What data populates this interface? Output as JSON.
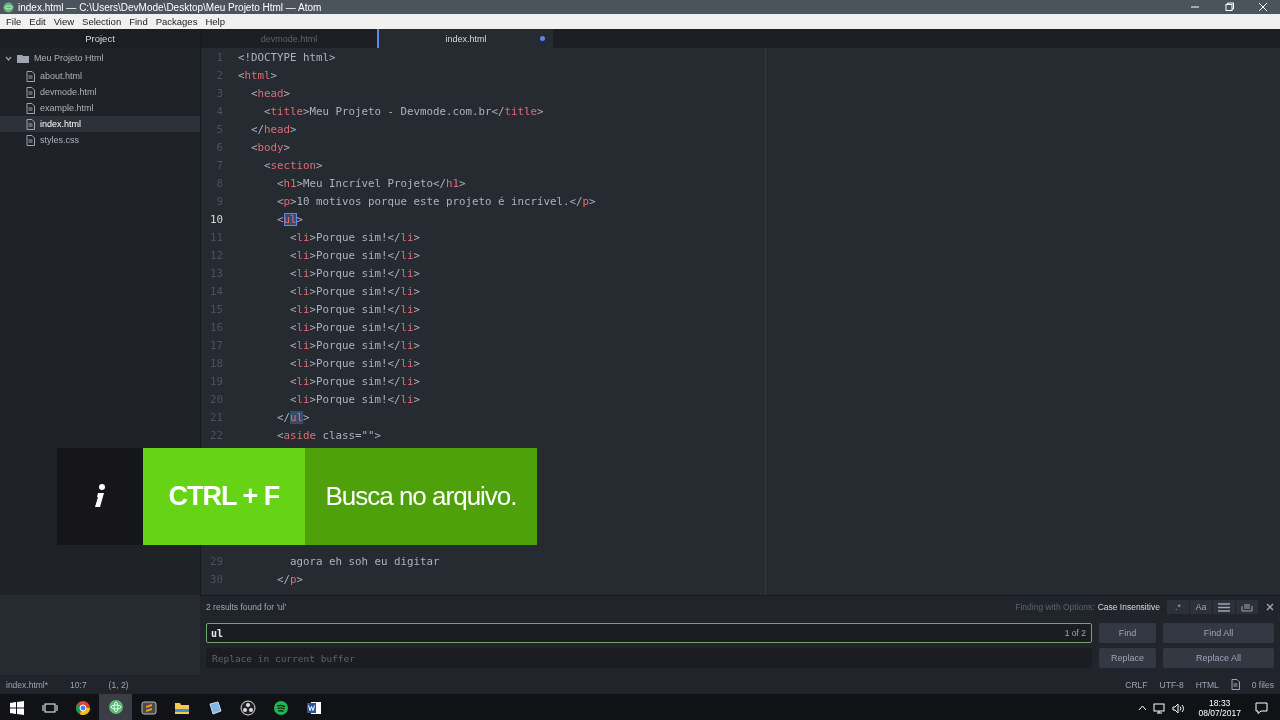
{
  "window": {
    "title": "index.html — C:\\Users\\DevMode\\Desktop\\Meu Projeto Html — Atom"
  },
  "menu": [
    "File",
    "Edit",
    "View",
    "Selection",
    "Find",
    "Packages",
    "Help"
  ],
  "sidebar": {
    "title": "Project",
    "tree": [
      {
        "label": "Meu Projeto Html",
        "expanded": true,
        "selected": false,
        "children": [
          {
            "label": "about.html",
            "selected": false
          },
          {
            "label": "devmode.html",
            "selected": false
          },
          {
            "label": "example.html",
            "selected": false
          },
          {
            "label": "index.html",
            "selected": true
          },
          {
            "label": "styles.css",
            "selected": false
          }
        ]
      }
    ]
  },
  "tabs": [
    {
      "label": "devmode.html",
      "selected": false,
      "modified": false
    },
    {
      "label": "index.html",
      "selected": true,
      "modified": true
    }
  ],
  "editor": {
    "lines": [
      {
        "number": "1",
        "current": false,
        "text": "<!DOCTYPE html>"
      },
      {
        "number": "2",
        "current": false,
        "text": "<html>"
      },
      {
        "number": "3",
        "current": false,
        "text": "  <head>"
      },
      {
        "number": "4",
        "current": false,
        "text": "    <title>Meu Projeto - Devmode.com.br</title>"
      },
      {
        "number": "5",
        "current": false,
        "text": "  </head>"
      },
      {
        "number": "6",
        "current": false,
        "text": "  <body>"
      },
      {
        "number": "7",
        "current": false,
        "text": "    <section>"
      },
      {
        "number": "8",
        "current": false,
        "text": "      <h1>Meu Incrível Projeto</h1>"
      },
      {
        "number": "9",
        "current": false,
        "text": "      <p>10 motivos porque este projeto é incrível.</p>"
      },
      {
        "number": "10",
        "current": true,
        "parts": [
          {
            "text": "      <",
            "kind": "text"
          },
          {
            "text": "ul",
            "kind": "current-match"
          },
          {
            "text": ">",
            "kind": "text"
          }
        ]
      },
      {
        "number": "11",
        "current": false,
        "text": "        <li>Porque sim!</li>"
      },
      {
        "number": "12",
        "current": false,
        "text": "        <li>Porque sim!</li>"
      },
      {
        "number": "13",
        "current": false,
        "text": "        <li>Porque sim!</li>"
      },
      {
        "number": "14",
        "current": false,
        "text": "        <li>Porque sim!</li>"
      },
      {
        "number": "15",
        "current": false,
        "text": "        <li>Porque sim!</li>"
      },
      {
        "number": "16",
        "current": false,
        "text": "        <li>Porque sim!</li>"
      },
      {
        "number": "17",
        "current": false,
        "text": "        <li>Porque sim!</li>"
      },
      {
        "number": "18",
        "current": false,
        "text": "        <li>Porque sim!</li>"
      },
      {
        "number": "19",
        "current": false,
        "text": "        <li>Porque sim!</li>"
      },
      {
        "number": "20",
        "current": false,
        "text": "        <li>Porque sim!</li>"
      },
      {
        "number": "21",
        "current": false,
        "parts": [
          {
            "text": "      </",
            "kind": "text"
          },
          {
            "text": "ul",
            "kind": "match"
          },
          {
            "text": ">",
            "kind": "text"
          }
        ]
      },
      {
        "number": "22",
        "current": false,
        "text": "      <aside class=\"\">"
      },
      {
        "number": "29",
        "current": false,
        "text": "        agora eh soh eu digitar"
      },
      {
        "number": "30",
        "current": false,
        "text": "      </p>"
      }
    ]
  },
  "banner": {
    "key": "CTRL + F",
    "caption": "Busca no arquivo."
  },
  "find": {
    "results": "2 results found for 'ul'",
    "options_label": "Finding with Options:",
    "options_value": "Case Insensitive",
    "options": [
      {
        "kind": "regex",
        "label": ".*",
        "on": false
      },
      {
        "kind": "case",
        "label": "Aa",
        "on": false
      },
      {
        "kind": "selection",
        "on": false
      },
      {
        "kind": "word",
        "on": false
      }
    ],
    "find_value": "ul",
    "counter": "1 of 2",
    "find_button": "Find",
    "find_all_button": "Find All",
    "replace_placeholder": "Replace in current buffer",
    "replace_button": "Replace",
    "replace_all_button": "Replace All"
  },
  "status_bar": {
    "left": [
      "index.html*",
      "10:7",
      "(1, 2)"
    ],
    "right": [
      "CRLF",
      "UTF-8",
      "HTML"
    ],
    "files": "0 files"
  },
  "taskbar": {
    "apps": [
      {
        "kind": "task-view",
        "active": false
      },
      {
        "kind": "browser",
        "active": false
      },
      {
        "kind": "atom",
        "active": true
      },
      {
        "kind": "sublime",
        "active": false
      },
      {
        "kind": "folder",
        "active": false
      },
      {
        "kind": "app",
        "active": false
      },
      {
        "kind": "obs",
        "active": false
      },
      {
        "kind": "music",
        "active": false
      },
      {
        "kind": "word",
        "active": false
      }
    ],
    "time": "18:33",
    "date": "08/07/2017"
  }
}
